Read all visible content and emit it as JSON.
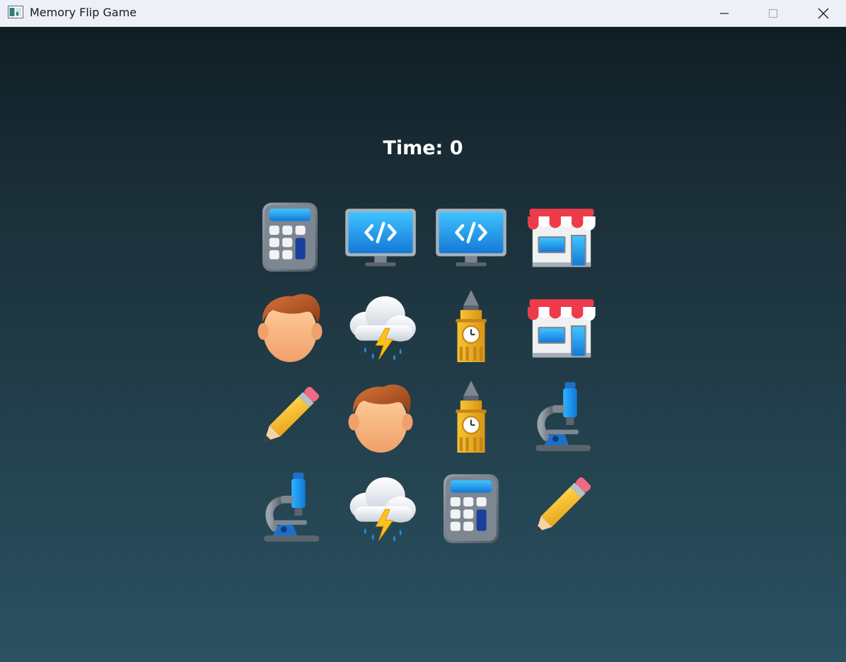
{
  "window": {
    "title": "Memory Flip Game",
    "controls": {
      "minimize_icon": "minimize-icon",
      "maximize_icon": "maximize-icon",
      "close_icon": "close-icon"
    }
  },
  "game": {
    "timer_label": "Time:",
    "timer_value": "0",
    "grid": {
      "rows": 4,
      "cols": 4,
      "cards": [
        [
          "calculator",
          "desktop-computer",
          "desktop-computer",
          "store"
        ],
        [
          "man-face",
          "thunder-cloud",
          "big-ben",
          "store"
        ],
        [
          "pencil",
          "man-face",
          "big-ben",
          "microscope"
        ],
        [
          "microscope",
          "thunder-cloud",
          "calculator",
          "pencil"
        ]
      ]
    }
  },
  "colors": {
    "background_top": "#101e25",
    "background_bottom": "#2b5262",
    "text": "#ffffff",
    "titlebar": "#eef0f7"
  }
}
